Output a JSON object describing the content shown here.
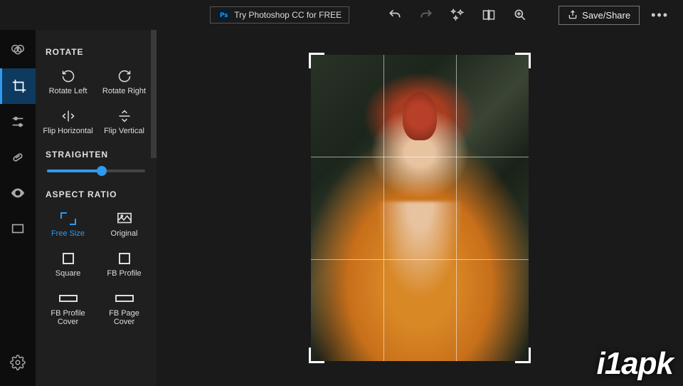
{
  "topbar": {
    "ps_badge": "Ps",
    "ps_label": "Try Photoshop CC for FREE",
    "save_label": "Save/Share"
  },
  "panel": {
    "rotate_title": "ROTATE",
    "rotate_left": "Rotate Left",
    "rotate_right": "Rotate Right",
    "flip_h": "Flip Horizontal",
    "flip_v": "Flip Vertical",
    "straighten_title": "STRAIGHTEN",
    "aspect_title": "ASPECT RATIO",
    "aspect": {
      "free": "Free Size",
      "original": "Original",
      "square": "Square",
      "fb_profile": "FB Profile",
      "fb_cover": "FB Profile Cover",
      "fb_page": "FB Page Cover"
    }
  },
  "watermark": "i1apk"
}
